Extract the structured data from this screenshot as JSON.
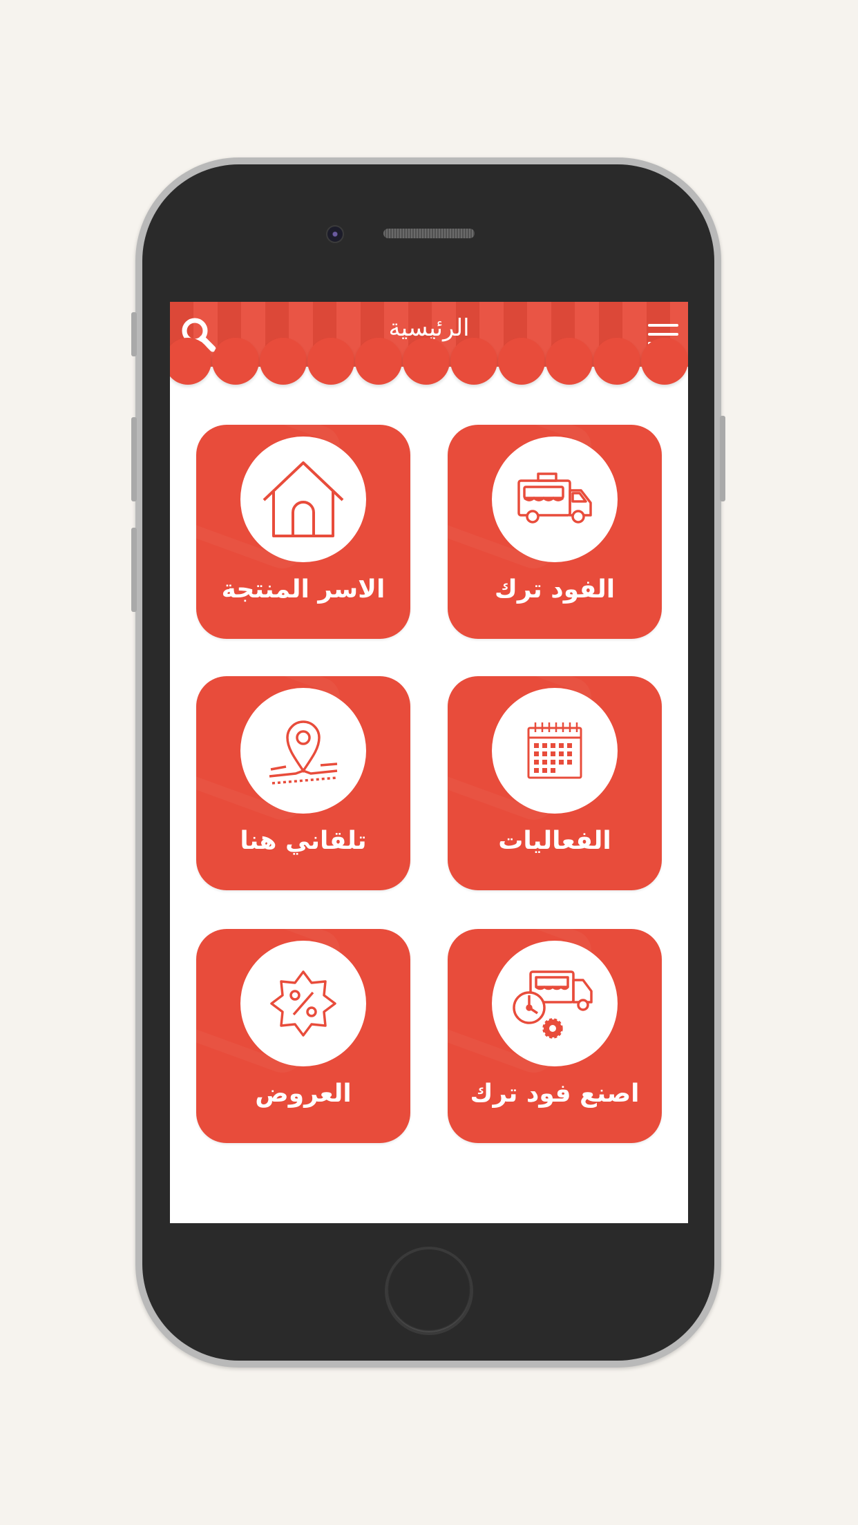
{
  "header": {
    "title": "الرئيسية"
  },
  "icons": {
    "search": "search-icon",
    "menu": "hamburger-menu-icon"
  },
  "colors": {
    "accent": "#e84c3b",
    "background": "#f6f3ee",
    "phone_body": "#2a2a2a"
  },
  "tiles": [
    {
      "label": "الفود ترك",
      "icon": "food-truck-icon"
    },
    {
      "label": "الاسر المنتجة",
      "icon": "home-icon"
    },
    {
      "label": "الفعاليات",
      "icon": "calendar-icon"
    },
    {
      "label": "تلقاني هنا",
      "icon": "location-pin-icon"
    },
    {
      "label": "اصنع فود ترك",
      "icon": "build-food-truck-icon"
    },
    {
      "label": "العروض",
      "icon": "discount-badge-icon"
    }
  ]
}
